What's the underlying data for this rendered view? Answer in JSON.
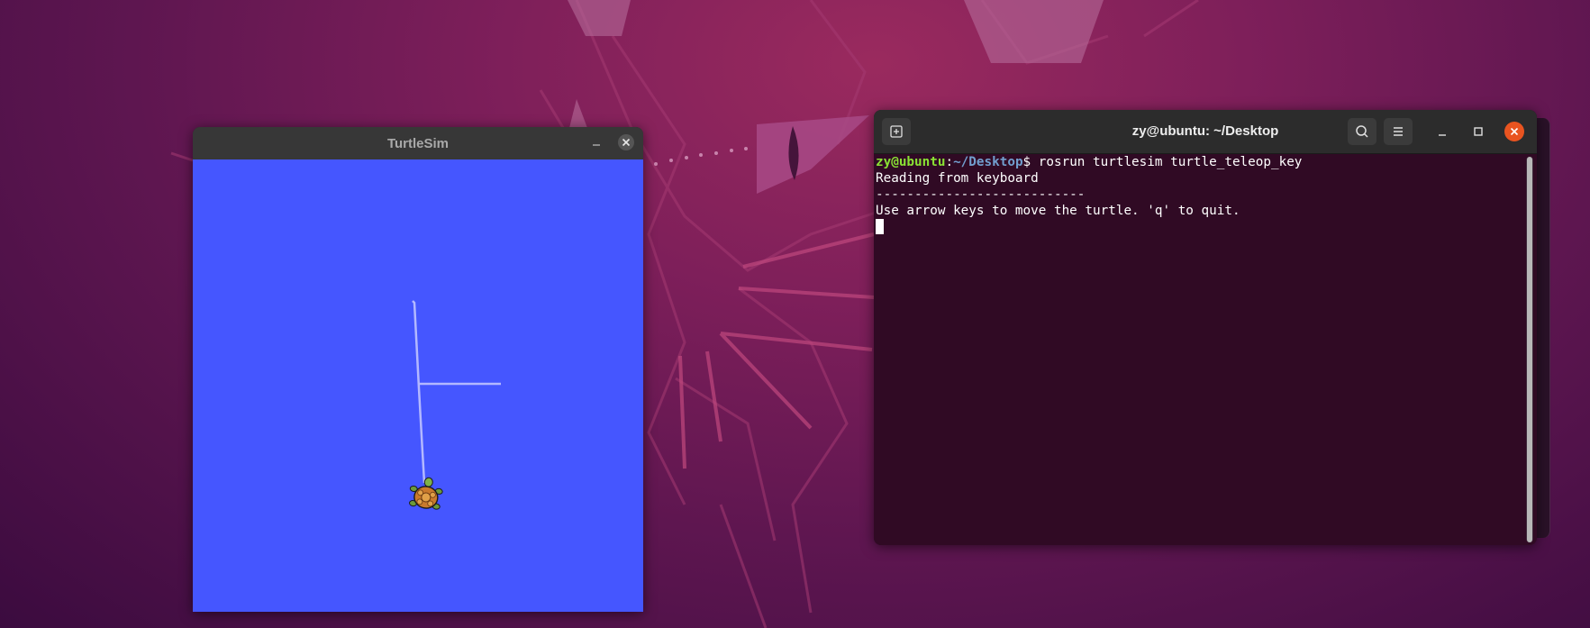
{
  "turtlesim": {
    "title": "TurtleSim",
    "minimize_icon": "minimize-icon",
    "close_icon": "close-icon",
    "canvas_color": "#4556ff",
    "trail_color": "#b3b8ff",
    "turtle_icon": "turtle-icon"
  },
  "terminal": {
    "title": "zy@ubuntu: ~/Desktop",
    "new_tab_icon": "new-tab-icon",
    "search_icon": "search-icon",
    "menu_icon": "hamburger-menu-icon",
    "minimize_icon": "minimize-icon",
    "maximize_icon": "maximize-icon",
    "close_icon": "close-icon",
    "prompt_user_host": "zy@ubuntu",
    "prompt_colon": ":",
    "prompt_path": "~/Desktop",
    "prompt_symbol": "$ ",
    "command": "rosrun turtlesim turtle_teleop_key",
    "output": [
      "Reading from keyboard",
      "---------------------------",
      "Use arrow keys to move the turtle. 'q' to quit."
    ]
  },
  "colors": {
    "terminal_bg": "#300a24",
    "prompt_user": "#8ae234",
    "prompt_path": "#729fcf",
    "close_button": "#e95420"
  }
}
